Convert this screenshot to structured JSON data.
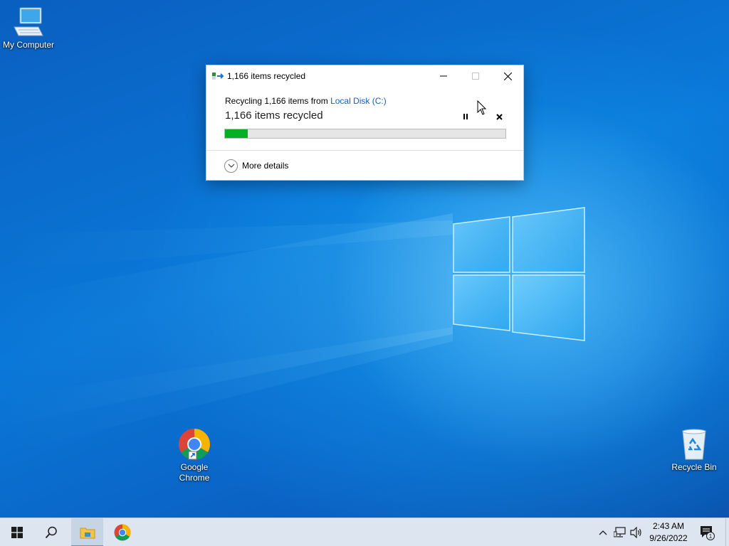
{
  "desktop": {
    "icons": [
      {
        "label": "My Computer",
        "icon": "computer-icon"
      },
      {
        "label": "Google\nChrome",
        "label_line1": "Google",
        "label_line2": "Chrome",
        "icon": "chrome-icon"
      },
      {
        "label": "Recycle Bin",
        "icon": "recycle-bin-icon"
      }
    ]
  },
  "dialog": {
    "title": "1,166 items recycled",
    "line1_prefix": "Recycling 1,166 items from ",
    "line1_link": "Local Disk (C:)",
    "status": "1,166 items recycled",
    "progress_fraction": 0.08,
    "progress_color": "#06b025",
    "more_details": "More details",
    "controls": [
      "minimize",
      "maximize",
      "close",
      "pause",
      "stop"
    ]
  },
  "taskbar": {
    "pinned": [
      "start-icon",
      "search-icon",
      "file-explorer-icon",
      "chrome-icon"
    ],
    "clock_time": "2:43 AM",
    "clock_date": "9/26/2022",
    "notification_count": "1"
  },
  "colors": {
    "accent": "#0078d7",
    "link": "#1a5fb4"
  }
}
